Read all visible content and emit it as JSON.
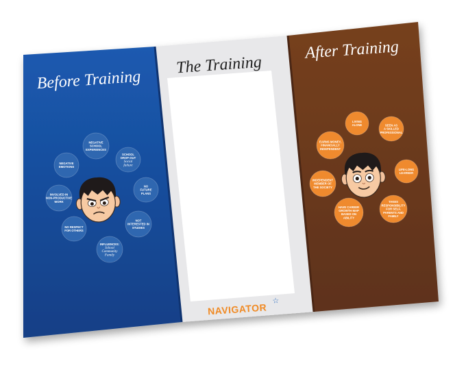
{
  "panels": {
    "before": {
      "title": "Before Training",
      "bubbles": [
        {
          "lines": [
            "NEGATIVE",
            "SCHOOL",
            "EXPERIENCES"
          ],
          "italic": []
        },
        {
          "lines": [
            "SCHOOL",
            "DROP-OUT"
          ],
          "italic": [
            "Social",
            "failure"
          ]
        },
        {
          "lines": [
            "NO",
            "FUTURE",
            "PLANS"
          ],
          "italic": []
        },
        {
          "lines": [
            "NOT",
            "INTERESTED IN",
            "STUDIES"
          ],
          "italic": []
        },
        {
          "lines": [
            "INFLUENCES:"
          ],
          "italic": [
            "School",
            "Community",
            "Family"
          ]
        },
        {
          "lines": [
            "NO RESPECT",
            "FOR OTHERS"
          ],
          "italic": []
        },
        {
          "lines": [
            "INVOLVED IN",
            "NON-PRODUCTIVE",
            "WORK"
          ],
          "italic": []
        },
        {
          "lines": [
            "NEGATIVE",
            "EMOTIONS"
          ],
          "italic": []
        }
      ]
    },
    "middle": {
      "title": "The Training",
      "brand": "NAVIGATOR",
      "brand_mark": "star-icon"
    },
    "after": {
      "title": "After Training",
      "bubbles": [
        {
          "lines": [
            "LIVING",
            "ALONE"
          ],
          "italic": []
        },
        {
          "lines": [
            "SEEN AS",
            "A SKILLED",
            "PROFESSIONAL"
          ],
          "italic": []
        },
        {
          "lines": [
            "LIFE-LONG",
            "LEARNER"
          ],
          "italic": []
        },
        {
          "lines": [
            "TAKES",
            "RESPONSIBILITY",
            "FOR SELF,",
            "PARENTS AND",
            "FAMILY"
          ],
          "italic": []
        },
        {
          "lines": [
            "HAVE CAREER",
            "GROWTH MAP",
            "BASED ON",
            "ABILITY"
          ],
          "italic": []
        },
        {
          "lines": [
            "INDEPENDENT",
            "MEMBER OF",
            "THE SOCIETY"
          ],
          "italic": []
        },
        {
          "lines": [
            "EARNS MONEY,",
            "FINANCIALLY",
            "INDEPENDENT"
          ],
          "italic": []
        }
      ]
    }
  },
  "colors": {
    "blue_panel": "#1a4d9c",
    "blue_bubble": "#2f67b0",
    "middle_panel": "#e8e8ea",
    "brown_panel": "#6e3a22",
    "orange_bubble": "#ef8a2e",
    "brand_orange": "#f08a24",
    "brand_star": "#2f6fc0"
  }
}
